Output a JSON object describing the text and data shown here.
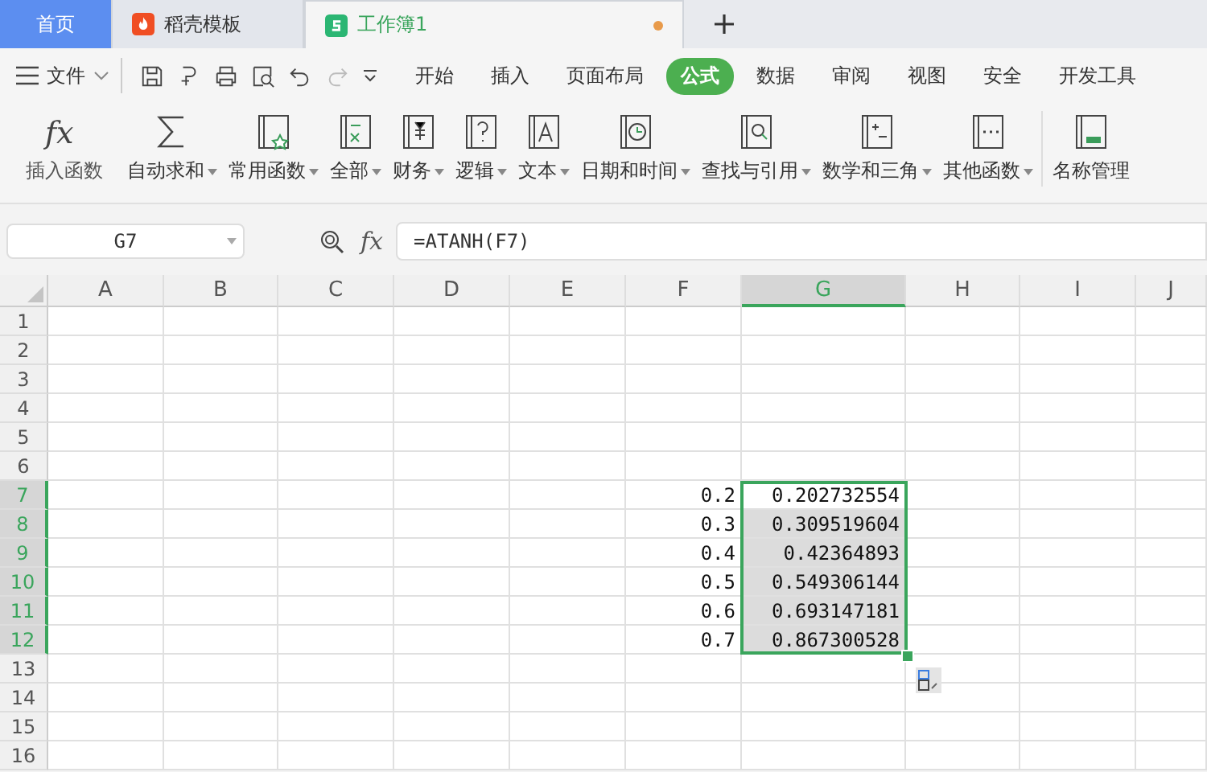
{
  "tabs": [
    {
      "label": "首页",
      "kind": "home",
      "selected": false,
      "modified": false
    },
    {
      "label": "稻壳模板",
      "kind": "docer",
      "selected": false,
      "modified": false
    },
    {
      "label": "工作簿1",
      "kind": "sheet",
      "selected": true,
      "modified": true
    }
  ],
  "menu": {
    "file": "文件",
    "items": [
      {
        "label": "开始",
        "selected": false
      },
      {
        "label": "插入",
        "selected": false
      },
      {
        "label": "页面布局",
        "selected": false
      },
      {
        "label": "公式",
        "selected": true
      },
      {
        "label": "数据",
        "selected": false
      },
      {
        "label": "审阅",
        "selected": false
      },
      {
        "label": "视图",
        "selected": false
      },
      {
        "label": "安全",
        "selected": false
      },
      {
        "label": "开发工具",
        "selected": false
      }
    ]
  },
  "ribbon": [
    {
      "label": "插入函数",
      "kind": "fx",
      "glyph": "fx",
      "dropdown": false
    },
    {
      "label": "自动求和",
      "kind": "sum",
      "dropdown": true
    },
    {
      "label": "常用函数",
      "kind": "star",
      "dropdown": true
    },
    {
      "label": "全部",
      "kind": "fxbook",
      "dropdown": true
    },
    {
      "label": "财务",
      "kind": "yen",
      "dropdown": true
    },
    {
      "label": "逻辑",
      "kind": "question",
      "dropdown": true
    },
    {
      "label": "文本",
      "kind": "letter",
      "dropdown": true
    },
    {
      "label": "日期和时间",
      "kind": "clock",
      "dropdown": true
    },
    {
      "label": "查找与引用",
      "kind": "lookup",
      "dropdown": true
    },
    {
      "label": "数学和三角",
      "kind": "math",
      "dropdown": true
    },
    {
      "label": "其他函数",
      "kind": "dots",
      "dropdown": true
    },
    {
      "label": "名称管理",
      "kind": "names",
      "dropdown": false
    }
  ],
  "formula_bar": {
    "name_box": "G7",
    "function_button": "fx",
    "formula": "=ATANH(F7)"
  },
  "sheet": {
    "columns": [
      {
        "label": "A",
        "selected": false
      },
      {
        "label": "B",
        "selected": false
      },
      {
        "label": "C",
        "selected": false
      },
      {
        "label": "D",
        "selected": false
      },
      {
        "label": "E",
        "selected": false
      },
      {
        "label": "F",
        "selected": false
      },
      {
        "label": "G",
        "selected": true
      },
      {
        "label": "H",
        "selected": false
      },
      {
        "label": "I",
        "selected": false
      },
      {
        "label": "J",
        "selected": false
      }
    ],
    "rows": [
      {
        "label": "1",
        "selected": false,
        "active": false
      },
      {
        "label": "2",
        "selected": false,
        "active": false
      },
      {
        "label": "3",
        "selected": false,
        "active": false
      },
      {
        "label": "4",
        "selected": false,
        "active": false
      },
      {
        "label": "5",
        "selected": false,
        "active": false
      },
      {
        "label": "6",
        "selected": false,
        "active": false
      },
      {
        "label": "7",
        "selected": true,
        "active": true,
        "F": "0.2",
        "G": "0.202732554"
      },
      {
        "label": "8",
        "selected": true,
        "active": false,
        "F": "0.3",
        "G": "0.309519604"
      },
      {
        "label": "9",
        "selected": true,
        "active": false,
        "F": "0.4",
        "G": "0.42364893"
      },
      {
        "label": "10",
        "selected": true,
        "active": false,
        "F": "0.5",
        "G": "0.549306144"
      },
      {
        "label": "11",
        "selected": true,
        "active": false,
        "F": "0.6",
        "G": "0.693147181"
      },
      {
        "label": "12",
        "selected": true,
        "active": false,
        "F": "0.7",
        "G": "0.867300528"
      },
      {
        "label": "13",
        "selected": false,
        "active": false
      },
      {
        "label": "14",
        "selected": false,
        "active": false
      },
      {
        "label": "15",
        "selected": false,
        "active": false
      },
      {
        "label": "16",
        "selected": false,
        "active": false
      }
    ]
  }
}
